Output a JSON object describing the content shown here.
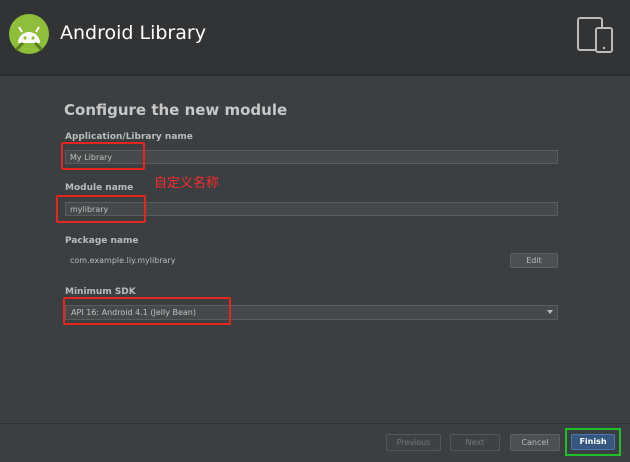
{
  "header": {
    "title": "Android Library",
    "logo_icon": "android-logo-icon",
    "device_icon": "tablet-phone-icon"
  },
  "form": {
    "section_title": "Configure the new module",
    "app_name_label": "Application/Library name",
    "app_name_value": "My Library",
    "module_name_label": "Module name",
    "module_name_value": "mylibrary",
    "package_label": "Package name",
    "package_value": "com.example.liy.mylibrary",
    "edit_label": "Edit",
    "min_sdk_label": "Minimum SDK",
    "min_sdk_value": "API 16: Android 4.1 (Jelly Bean)"
  },
  "annotation": {
    "text": "自定义名称",
    "color": "#e5261f"
  },
  "footer": {
    "previous_label": "Previous",
    "next_label": "Next",
    "cancel_label": "Cancel",
    "finish_label": "Finish"
  },
  "colors": {
    "accent_green": "#1fbf2a",
    "primary_blue": "#365880",
    "android_green": "#a4c639"
  }
}
